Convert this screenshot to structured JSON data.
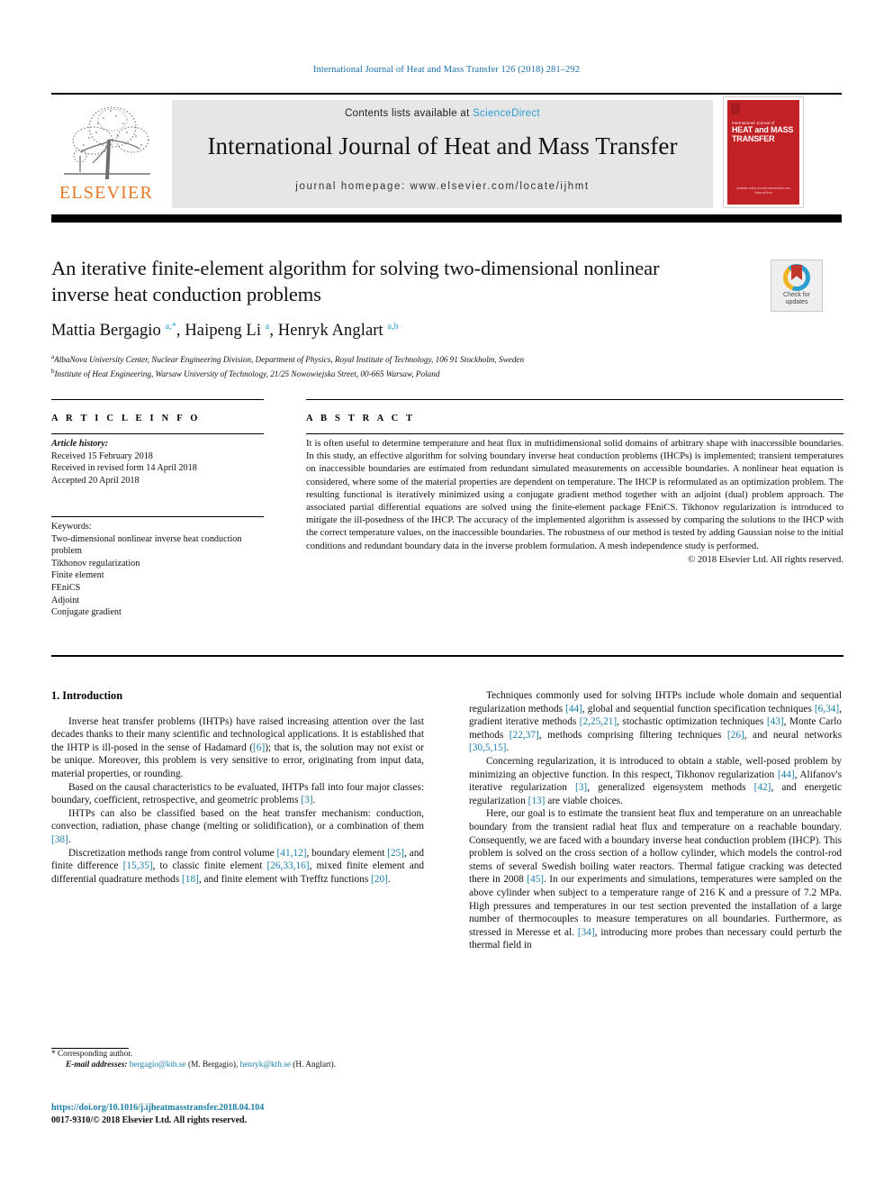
{
  "running_head": "International Journal of Heat and Mass Transfer 126 (2018) 281–292",
  "masthead": {
    "contents_prefix": "Contents lists available at ",
    "sciencedirect": "ScienceDirect",
    "journal_title": "International Journal of Heat and Mass Transfer",
    "homepage": "journal homepage: www.elsevier.com/locate/ijhmt",
    "publisher": "ELSEVIER",
    "cover": {
      "kicker": "International Journal of",
      "title_line1": "HEAT and MASS",
      "title_line2": "TRANSFER",
      "footer": "Available online at www.sciencedirect.com\nScienceDirect"
    }
  },
  "article": {
    "title": "An iterative finite-element algorithm for solving two-dimensional nonlinear inverse heat conduction problems",
    "authors_html": "Mattia Bergagio <sup>a,*</sup>, Haipeng Li <sup>a</sup>, Henryk Anglart <sup>a,b</sup>",
    "affiliation_a": "AlbaNova University Center, Nuclear Engineering Division, Department of Physics, Royal Institute of Technology, 106 91 Stockholm, Sweden",
    "affiliation_b": "Institute of Heat Engineering, Warsaw University of Technology, 21/25 Nowowiejska Street, 00-665 Warsaw, Poland",
    "crossmark_label": "Check for updates"
  },
  "info": {
    "heading": "A R T I C L E   I N F O",
    "history_label": "Article history:",
    "history": [
      "Received 15 February 2018",
      "Received in revised form 14 April 2018",
      "Accepted 20 April 2018"
    ],
    "keywords_label": "Keywords:",
    "keywords": [
      "Two-dimensional nonlinear inverse heat conduction problem",
      "Tikhonov regularization",
      "Finite element",
      "FEniCS",
      "Adjoint",
      "Conjugate gradient"
    ]
  },
  "abstract": {
    "heading": "A B S T R A C T",
    "text": "It is often useful to determine temperature and heat flux in multidimensional solid domains of arbitrary shape with inaccessible boundaries. In this study, an effective algorithm for solving boundary inverse heat conduction problems (IHCPs) is implemented; transient temperatures on inaccessible boundaries are estimated from redundant simulated measurements on accessible boundaries. A nonlinear heat equation is considered, where some of the material properties are dependent on temperature. The IHCP is reformulated as an optimization problem. The resulting functional is iteratively minimized using a conjugate gradient method together with an adjoint (dual) problem approach. The associated partial differential equations are solved using the finite-element package FEniCS. Tikhonov regularization is introduced to mitigate the ill-posedness of the IHCP. The accuracy of the implemented algorithm is assessed by comparing the solutions to the IHCP with the correct temperature values, on the inaccessible boundaries. The robustness of our method is tested by adding Gaussian noise to the initial conditions and redundant boundary data in the inverse problem formulation. A mesh independence study is performed.",
    "copyright": "© 2018 Elsevier Ltd. All rights reserved."
  },
  "body": {
    "section_number_title": "1. Introduction",
    "left_paragraphs": [
      "Inverse heat transfer problems (IHTPs) have raised increasing attention over the last decades thanks to their many scientific and technological applications. It is established that the IHTP is ill-posed in the sense of Hadamard ([6]); that is, the solution may not exist or be unique. Moreover, this problem is very sensitive to error, originating from input data, material properties, or rounding.",
      "Based on the causal characteristics to be evaluated, IHTPs fall into four major classes: boundary, coefficient, retrospective, and geometric problems [3].",
      "IHTPs can also be classified based on the heat transfer mechanism: conduction, convection, radiation, phase change (melting or solidification), or a combination of them [38].",
      "Discretization methods range from control volume [41,12], boundary element [25], and finite difference [15,35], to classic finite element [26,33,16], mixed finite element and differential quadrature methods [18], and finite element with Trefftz functions [20]."
    ],
    "right_paragraphs": [
      "Techniques commonly used for solving IHTPs include whole domain and sequential regularization methods [44], global and sequential function specification techniques [6,34], gradient iterative methods [2,25,21], stochastic optimization techniques [43], Monte Carlo methods [22,37], methods comprising filtering techniques [26], and neural networks [30,5,15].",
      "Concerning regularization, it is introduced to obtain a stable, well-posed problem by minimizing an objective function. In this respect, Tikhonov regularization [44], Alifanov's iterative regularization [3], generalized eigensystem methods [42], and energetic regularization [13] are viable choices.",
      "Here, our goal is to estimate the transient heat flux and temperature on an unreachable boundary from the transient radial heat flux and temperature on a reachable boundary. Consequently, we are faced with a boundary inverse heat conduction problem (IHCP). This problem is solved on the cross section of a hollow cylinder, which models the control-rod stems of several Swedish boiling water reactors. Thermal fatigue cracking was detected there in 2008 [45]. In our experiments and simulations, temperatures were sampled on the above cylinder when subject to a temperature range of 216 K and a pressure of 7.2 MPa. High pressures and temperatures in our test section prevented the installation of a large number of thermocouples to measure temperatures on all boundaries. Furthermore, as stressed in Meresse et al. [34], introducing more probes than necessary could perturb the thermal field in"
    ]
  },
  "footnote": {
    "star": "*",
    "corresponding": "Corresponding author.",
    "email_label": "E-mail addresses:",
    "email1": "bergagio@kth.se",
    "email1_name": "(M. Bergagio),",
    "email2": "henryk@kth.se",
    "email2_name": "(H. Anglart)."
  },
  "footer": {
    "doi": "https://doi.org/10.1016/j.ijheatmasstransfer.2018.04.104",
    "issn": "0017-9310/© 2018 Elsevier Ltd. All rights reserved."
  },
  "colors": {
    "link": "#1b7fa8",
    "sciencedirect": "#2a9fd0",
    "elsevier_orange": "#e87722",
    "cover_red": "#c22126"
  }
}
